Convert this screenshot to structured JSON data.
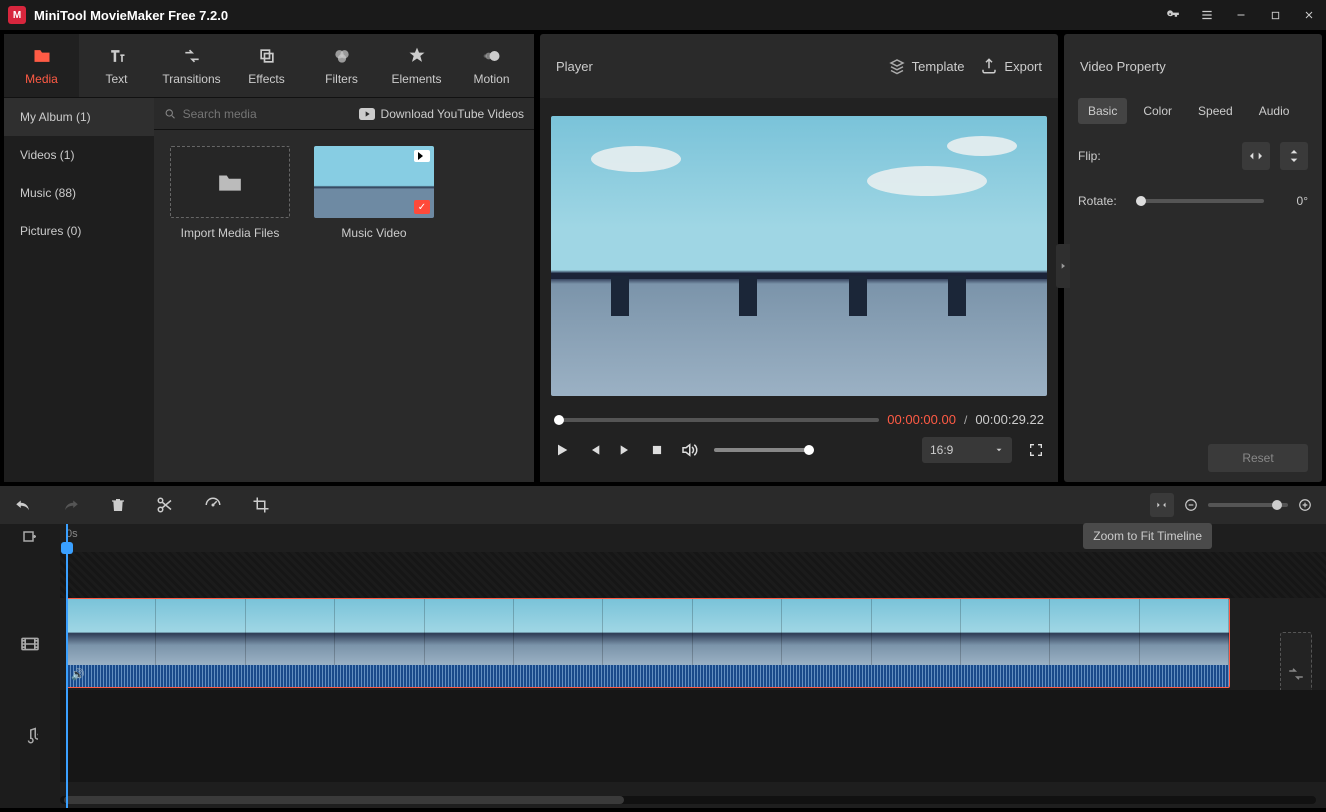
{
  "titlebar": {
    "title": "MiniTool MovieMaker Free 7.2.0"
  },
  "libTabs": {
    "media": "Media",
    "text": "Text",
    "transitions": "Transitions",
    "effects": "Effects",
    "filters": "Filters",
    "elements": "Elements",
    "motion": "Motion"
  },
  "libSide": {
    "myAlbum": "My Album (1)",
    "videos": "Videos (1)",
    "music": "Music (88)",
    "pictures": "Pictures (0)"
  },
  "search": {
    "placeholder": "Search media"
  },
  "downloadYT": "Download YouTube Videos",
  "thumbs": {
    "import": "Import Media Files",
    "clip1": "Music Video"
  },
  "player": {
    "title": "Player",
    "template": "Template",
    "export": "Export",
    "current": "00:00:00.00",
    "sep": "/",
    "total": "00:00:29.22",
    "ratio": "16:9"
  },
  "prop": {
    "title": "Video Property",
    "tabs": {
      "basic": "Basic",
      "color": "Color",
      "speed": "Speed",
      "audio": "Audio"
    },
    "flip": "Flip:",
    "rotate": "Rotate:",
    "rotVal": "0°",
    "reset": "Reset"
  },
  "tooltip": "Zoom to Fit Timeline",
  "ruler0": "0s"
}
